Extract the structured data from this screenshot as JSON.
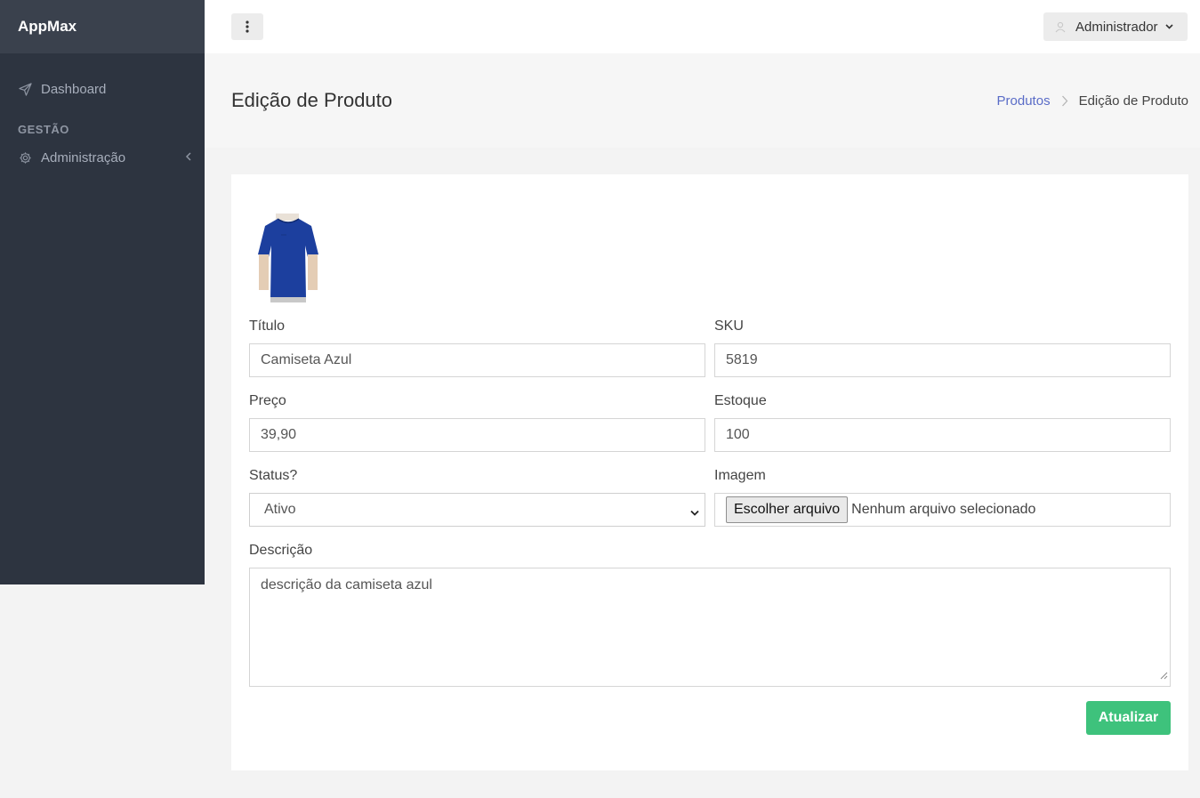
{
  "brand": "AppMax",
  "sidebar": {
    "items": [
      {
        "label": "Dashboard",
        "icon": "send-icon"
      },
      {
        "section": "GESTÃO"
      },
      {
        "label": "Administração",
        "icon": "gear-icon"
      }
    ]
  },
  "topbar": {
    "user": "Administrador"
  },
  "page": {
    "title": "Edição de Produto",
    "breadcrumb": [
      "Produtos",
      "Edição de Produto"
    ]
  },
  "form": {
    "titulo_label": "Título",
    "titulo_value": "Camiseta Azul",
    "sku_label": "SKU",
    "sku_value": "5819",
    "preco_label": "Preço",
    "preco_value": "39,90",
    "estoque_label": "Estoque",
    "estoque_value": "100",
    "status_label": "Status?",
    "status_value": "Ativo",
    "imagem_label": "Imagem",
    "file_button": "Escolher arquivo",
    "file_status": "Nenhum arquivo selecionado",
    "descricao_label": "Descrição",
    "descricao_value": "descrição da camiseta azul",
    "submit_label": "Atualizar"
  },
  "colors": {
    "sidebar": "#2d3440",
    "brand_bar": "#3a414d",
    "accent_link": "#5a6cc7",
    "submit": "#3ec27c",
    "shirt": "#1c3f9e"
  }
}
